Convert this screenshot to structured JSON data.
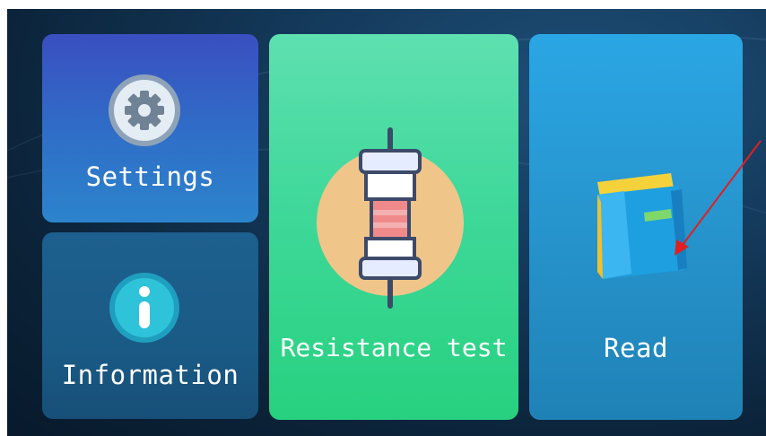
{
  "tiles": {
    "settings": {
      "label": "Settings",
      "icon": "gear-icon",
      "color": "#3a4fc0"
    },
    "information": {
      "label": "Information",
      "icon": "info-icon",
      "color": "#1d5f8e"
    },
    "resistance_test": {
      "label": "Resistance test",
      "icon": "resistor-icon",
      "color": "#3fd89a"
    },
    "read": {
      "label": "Read",
      "icon": "book-icon",
      "color": "#2aa6e4"
    }
  },
  "annotation": {
    "icon": "red-arrow-icon",
    "color": "#e02020"
  }
}
